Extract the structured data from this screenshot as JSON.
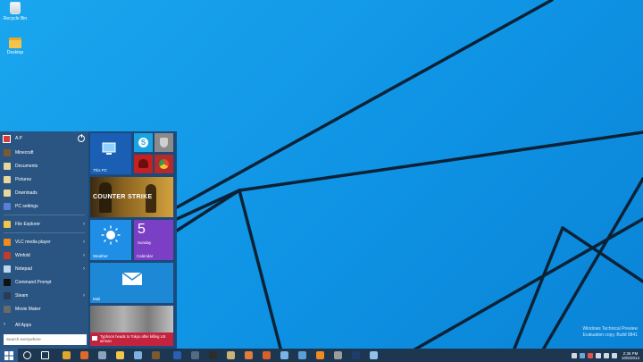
{
  "desktop": {
    "icons": [
      {
        "label": "Recycle Bin"
      },
      {
        "label": "Desktop"
      }
    ],
    "watermark": {
      "line1": "Windows Technical Preview",
      "line2": "Evaluation copy. Build 9841"
    }
  },
  "start_menu": {
    "user_name": "A P",
    "apps": [
      {
        "label": "Minecraft",
        "icon": "minecraft-icon",
        "color": "#7a5a2e",
        "arrow": false
      },
      {
        "label": "Documents",
        "icon": "documents-icon",
        "color": "#e8d79a",
        "arrow": false
      },
      {
        "label": "Pictures",
        "icon": "pictures-icon",
        "color": "#e8d79a",
        "arrow": false
      },
      {
        "label": "Downloads",
        "icon": "downloads-icon",
        "color": "#e8d79a",
        "arrow": false
      },
      {
        "label": "PC settings",
        "icon": "gear-icon",
        "color": "#5a7fd4",
        "arrow": false
      },
      {
        "label": "File Explorer",
        "icon": "folder-icon",
        "color": "#f2c54b",
        "arrow": true
      },
      {
        "label": "VLC media player",
        "icon": "vlc-icon",
        "color": "#f28a1d",
        "arrow": true
      },
      {
        "label": "Winfold",
        "icon": "winfold-icon",
        "color": "#c43b2a",
        "arrow": true
      },
      {
        "label": "Notepad",
        "icon": "notepad-icon",
        "color": "#bfd6f2",
        "arrow": true
      },
      {
        "label": "Command Prompt",
        "icon": "command-prompt-icon",
        "color": "#111111",
        "arrow": false
      },
      {
        "label": "Steam",
        "icon": "steam-icon",
        "color": "#2b3b52",
        "arrow": true
      },
      {
        "label": "Movie Maker",
        "icon": "movie-maker-icon",
        "color": "#6a6a6a",
        "arrow": false
      }
    ],
    "all_apps": "All Apps",
    "search_placeholder": "Search everywhere",
    "tiles": {
      "this_pc": "This PC",
      "counter_strike_title": "COUNTER STRIKE",
      "weather": "Weather",
      "calendar_day": "5",
      "calendar_weekday": "Sunday",
      "calendar": "Calendar",
      "mail": "Mail",
      "news_headline": "Typhoon heads to Tokyo after killing US airman"
    }
  },
  "taskbar": {
    "clock_time": "2:35 PM",
    "clock_date": "10/5/2014",
    "apps": [
      {
        "icon": "search-icon",
        "color": "#ffffff"
      },
      {
        "icon": "task-view-icon",
        "color": "#ffffff"
      },
      {
        "icon": "chrome-icon",
        "color": "#e0a52c"
      },
      {
        "icon": "firefox-icon",
        "color": "#e0692a"
      },
      {
        "icon": "steam-icon",
        "color": "#8aa3bf"
      },
      {
        "icon": "file-explorer-icon",
        "color": "#f2c54b"
      },
      {
        "icon": "remote-desktop-icon",
        "color": "#7fb1e0"
      },
      {
        "icon": "minecraft-icon",
        "color": "#7a5a2e"
      },
      {
        "icon": "word-icon",
        "color": "#2b5fb3"
      },
      {
        "icon": "photos-icon",
        "color": "#556b82"
      },
      {
        "icon": "cmd-icon",
        "color": "#2d2d2d"
      },
      {
        "icon": "winamp-icon",
        "color": "#c9b37a"
      },
      {
        "icon": "paint-icon",
        "color": "#e27c3e"
      },
      {
        "icon": "firefox-icon-2",
        "color": "#d9602a"
      },
      {
        "icon": "virtualbox-icon",
        "color": "#79b4e6"
      },
      {
        "icon": "store-icon",
        "color": "#5aa0d6"
      },
      {
        "icon": "vlc-icon",
        "color": "#f28a1d"
      },
      {
        "icon": "mail-icon",
        "color": "#9c9c9c"
      },
      {
        "icon": "photoshop-icon",
        "color": "#1f3d6b"
      },
      {
        "icon": "network-icon",
        "color": "#8fc1ea"
      }
    ],
    "tray_icons": [
      {
        "icon": "chevron-up-icon",
        "color": "#cfd8e3"
      },
      {
        "icon": "shield-icon",
        "color": "#6aa4d9"
      },
      {
        "icon": "flag-icon",
        "color": "#e35050"
      },
      {
        "icon": "speaker-icon",
        "color": "#cfd8e3"
      },
      {
        "icon": "wifi-icon",
        "color": "#cfd8e3"
      },
      {
        "icon": "keyboard-icon",
        "color": "#cfd8e3"
      }
    ]
  }
}
